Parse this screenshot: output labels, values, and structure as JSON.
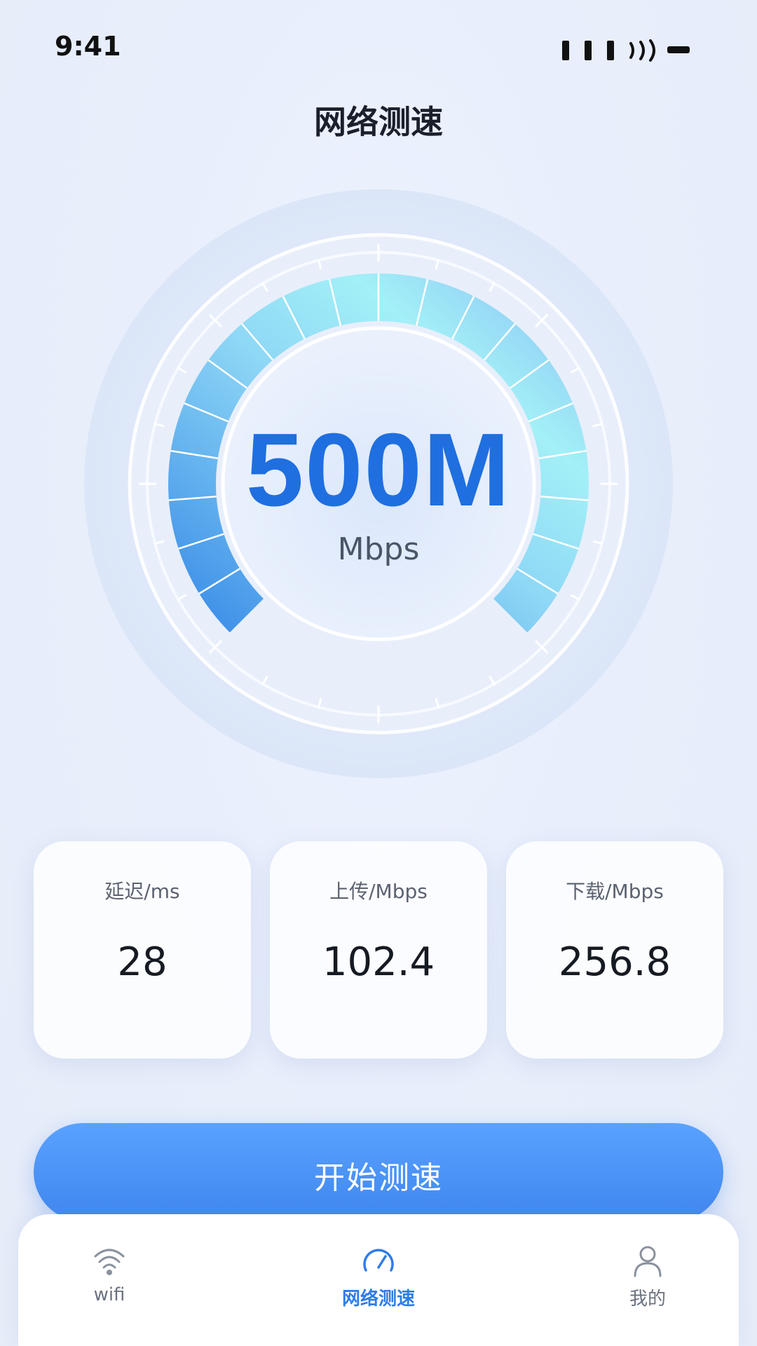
{
  "status_bar": {
    "time": "9:41"
  },
  "header": {
    "title": "网络测速"
  },
  "gauge": {
    "value": "500M",
    "unit": "Mbps"
  },
  "stats": [
    {
      "label": "延迟/ms",
      "value": "28"
    },
    {
      "label": "上传/Mbps",
      "value": "102.4"
    },
    {
      "label": "下载/Mbps",
      "value": "256.8"
    }
  ],
  "start_button": {
    "label": "开始测速"
  },
  "tabbar": {
    "items": [
      {
        "label": "wifi",
        "icon": "wifi-icon",
        "active": false
      },
      {
        "label": "网络测速",
        "icon": "speedometer-icon",
        "active": true
      },
      {
        "label": "我的",
        "icon": "user-icon",
        "active": false
      }
    ]
  },
  "colors": {
    "accent": "#2f7ce8",
    "speed_text": "#1f6fe0",
    "button": "#4a90f5",
    "gauge_start": "#3d8fe8",
    "gauge_end": "#9aeaf5"
  }
}
